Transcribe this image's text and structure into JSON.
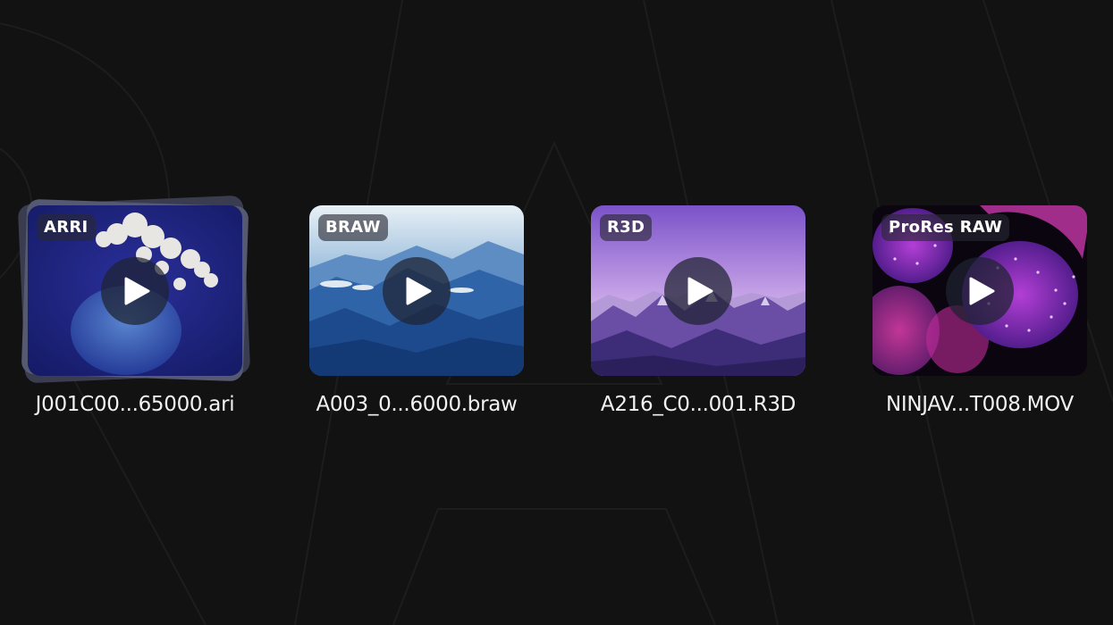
{
  "files": [
    {
      "format": "ARRI",
      "filename": "J001C00...65000.ari",
      "thumbnail": "jellyfish-blue",
      "stacked": true
    },
    {
      "format": "BRAW",
      "filename": "A003_0...6000.braw",
      "thumbnail": "mountains-blue",
      "stacked": false
    },
    {
      "format": "R3D",
      "filename": "A216_C0...001.R3D",
      "thumbnail": "mountains-purple",
      "stacked": false
    },
    {
      "format": "ProRes RAW",
      "filename": "NINJAV...T008.MOV",
      "thumbnail": "jellyfish-pink",
      "stacked": false
    }
  ],
  "icons": {
    "play": "play-icon"
  },
  "colors": {
    "background": "#121212",
    "text": "#f2f2f2",
    "badge_bg": "rgba(40,40,50,0.62)"
  }
}
